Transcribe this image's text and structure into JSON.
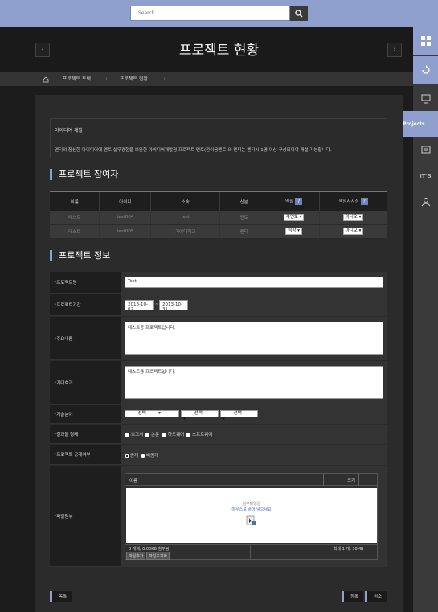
{
  "search": {
    "placeholder": "Search"
  },
  "header": {
    "title": "프로젝트 현황"
  },
  "breadcrumb": {
    "items": [
      "프로젝트 트랙",
      "프로젝트 현황"
    ]
  },
  "sidebar": {
    "projects_label": "Projects",
    "its_label": "IT'S"
  },
  "intro": {
    "title": "아이디어 개발",
    "description": "멘티의 참신한 아이디어에 멘토 실무경험을 보완한 아이디어개발형 프로젝트 멘토(한이음멘토)와 멘티는 멘티시 1명 이상 구성되어야 개설 가능합니다."
  },
  "participants": {
    "heading": "프로젝트 참여자",
    "columns": [
      "이름",
      "아이디",
      "소속",
      "신분",
      "역할",
      "책임자지정"
    ],
    "help": "?",
    "rows": [
      {
        "name": "테스트",
        "id": "test004",
        "org": "test",
        "status": "멘토",
        "role": "주멘토",
        "leader": "아니오"
      },
      {
        "name": "테스트",
        "id": "test005",
        "org": "가야대학교",
        "status": "멘티",
        "role": "팀장",
        "leader": "아니오"
      }
    ]
  },
  "info": {
    "heading": "프로젝트 정보",
    "name_label": "프로젝트명",
    "name_value": "Test",
    "period_label": "프로젝트기간",
    "start_date": "2013-10-02",
    "date_sep": "~",
    "end_date": "2013-10-31",
    "main_label": "주요내용",
    "main_value": "테스트용 프로젝트입니다.",
    "effect_label": "기대효과",
    "effect_value": "테스트용 프로젝트입니다.",
    "tech_label": "기술분야",
    "tech_option": "------ 선택 ------",
    "result_label": "결과물 형태",
    "result_options": [
      "보고서",
      "논문",
      "하드웨어",
      "소프트웨어"
    ],
    "public_label": "프로젝트 공개여부",
    "public_options": [
      "공개",
      "비공개"
    ],
    "file_label": "파일첨부",
    "file_col_name": "이름",
    "file_col_size": "크기",
    "drop_line1": "첨부파일을",
    "drop_line2": "마우스로 끌어 넣으세요",
    "file_status": "0 개체, 0.00KB 첨부됨",
    "file_limit": "최대 1 개, 30MB",
    "add_file": "파일추가",
    "reset_file": "파일초기화"
  },
  "footer": {
    "list": "목록",
    "register": "등록",
    "cancel": "취소"
  }
}
